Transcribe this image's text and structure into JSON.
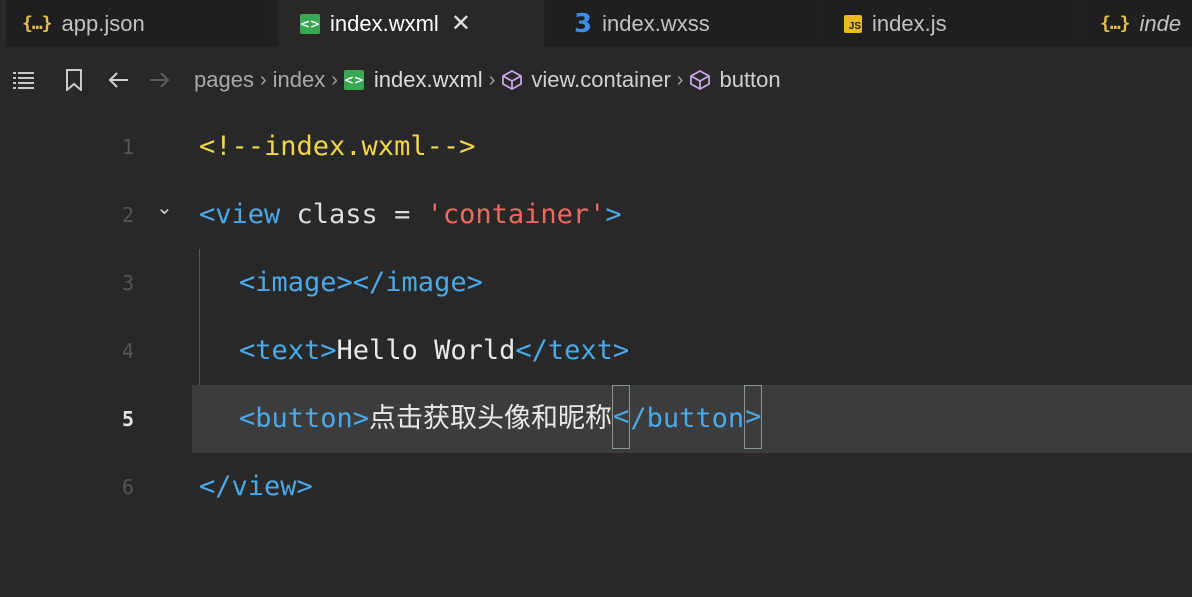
{
  "tabs": [
    {
      "icon": "json-braces-icon",
      "label": "app.json",
      "active": false
    },
    {
      "icon": "wxml-file-icon",
      "label": "index.wxml",
      "active": true,
      "close": "✕"
    },
    {
      "icon": "css-file-icon",
      "label": "index.wxss",
      "active": false
    },
    {
      "icon": "js-file-icon",
      "label": "index.js",
      "active": false
    },
    {
      "icon": "json-braces-icon",
      "label": "inde",
      "active": false
    }
  ],
  "icon_glyphs": {
    "json": "{…}",
    "wxml": "<>",
    "css": "3",
    "js": "JS"
  },
  "breadcrumb": [
    "pages",
    "index",
    "index.wxml",
    "view.container",
    "button"
  ],
  "editor": {
    "current_line": 5,
    "lines": [
      {
        "num": "1"
      },
      {
        "num": "2"
      },
      {
        "num": "3"
      },
      {
        "num": "4"
      },
      {
        "num": "5"
      },
      {
        "num": "6"
      }
    ],
    "code": {
      "l1_comment": "<!--index.wxml-->",
      "l2_open": "<view",
      "l2_attr": " class = ",
      "l2_str": "'container'",
      "l2_close": ">",
      "l3_tags": "<image></image>",
      "l4_open": "<text>",
      "l4_text": "Hello World",
      "l4_close": "</text>",
      "l5_open": "<button>",
      "l5_text": "点击获取头像和昵称",
      "l5_lt": "<",
      "l5_close_name": "/button",
      "l5_gt": ">",
      "l6_close": "</view>"
    }
  },
  "colors": {
    "tag": "#4aa9e8",
    "comment": "#f0d64a",
    "string": "#ec6a5f",
    "background": "#282828"
  }
}
